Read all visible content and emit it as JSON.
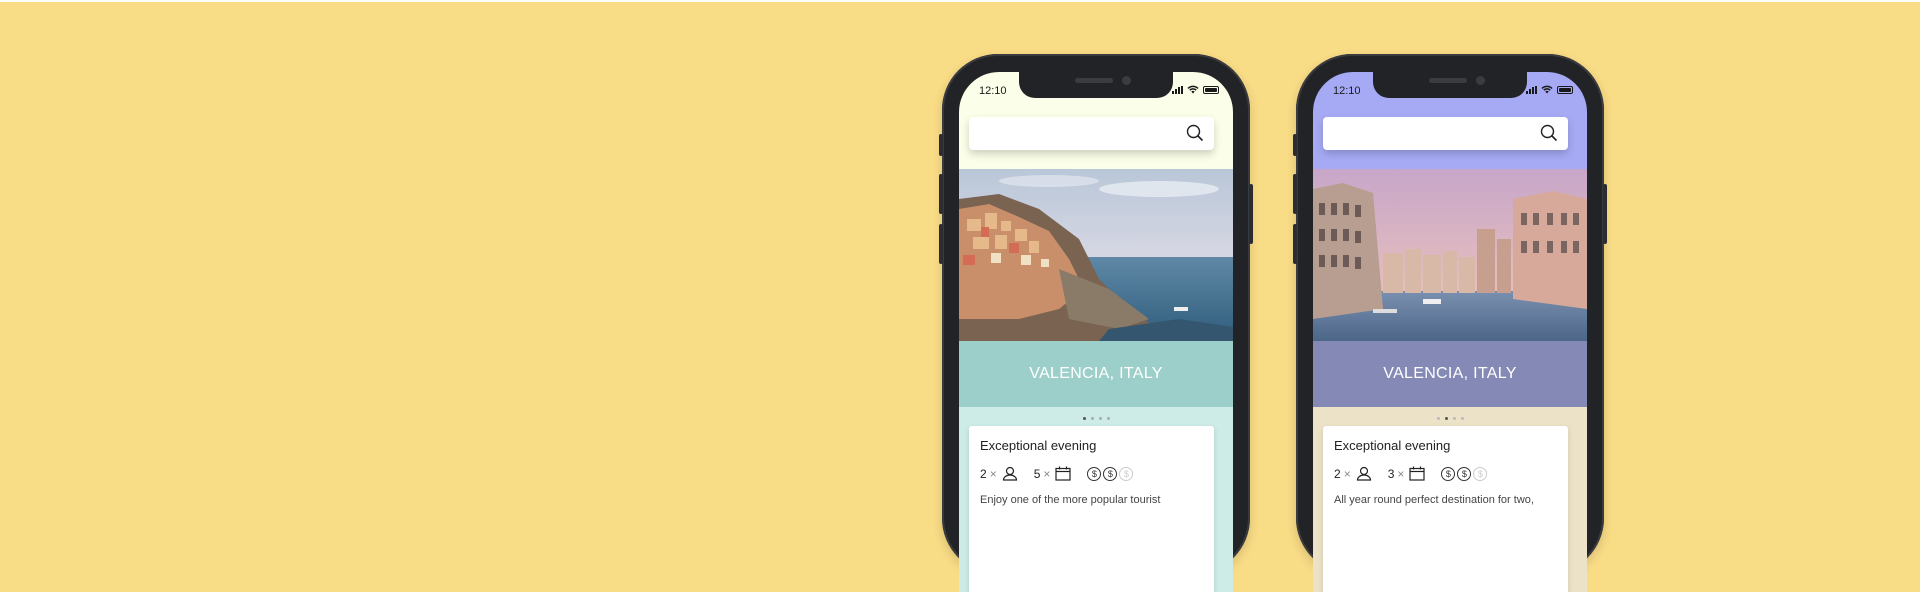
{
  "phones": [
    {
      "status_time": "12:10",
      "destination": "VALENCIA, ITALY",
      "carousel": {
        "count": 4,
        "active": 0
      },
      "card": {
        "title": "Exceptional evening",
        "guests": "2",
        "days": "5",
        "price_level": 2,
        "price_max": 3,
        "description": "Enjoy one of the more popular tourist"
      },
      "colors": {
        "top": "#fbfee8",
        "band": "#9dcfca",
        "lower": "#cdebe7"
      }
    },
    {
      "status_time": "12:10",
      "destination": "VALENCIA, ITALY",
      "carousel": {
        "count": 4,
        "active": 1
      },
      "card": {
        "title": "Exceptional evening",
        "guests": "2",
        "days": "3",
        "price_level": 2,
        "price_max": 3,
        "description": "All year round perfect destination for two,"
      },
      "colors": {
        "top": "#a6aaf4",
        "band": "#8589b5",
        "lower": "#ece2c7"
      }
    }
  ],
  "icons": {
    "search": "search-icon",
    "guests": "person-icon",
    "days": "calendar-icon",
    "price": "dollar-coin-icon"
  },
  "background_color": "#f9dc86"
}
